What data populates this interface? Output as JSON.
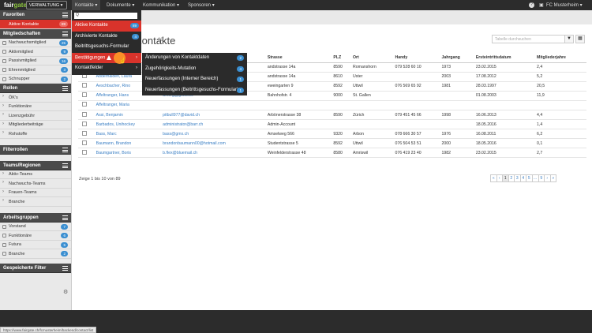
{
  "topbar": {
    "logo_a": "fair",
    "logo_b": "gate",
    "org_switch": "VERWALTUNG",
    "nav": [
      "Kontakte",
      "Dokumente",
      "Kommunikation",
      "Sponsoren"
    ],
    "help": "?",
    "user": "FC Musterheim"
  },
  "sidebar": {
    "favoriten": {
      "title": "Favoriten",
      "items": [
        {
          "label": "Aktive Kontakte",
          "count": "89"
        }
      ]
    },
    "mitgliedschaften": {
      "title": "Mitgliedschaften",
      "items": [
        {
          "label": "Nachwuchsmitglied",
          "count": "25"
        },
        {
          "label": "Aktivmitglied",
          "count": "9"
        },
        {
          "label": "Passivmitglied",
          "count": "16"
        },
        {
          "label": "Ehrenmitglied",
          "count": "3"
        },
        {
          "label": "Schnupper",
          "count": "2"
        }
      ]
    },
    "rollen": {
      "title": "Rollen",
      "items": [
        "ÖK's",
        "Funktionäre",
        "Lizenzgebühr",
        "Mitgliederbeiträge",
        "Rohstoffe"
      ]
    },
    "filterrollen": {
      "title": "Filterrollen"
    },
    "teams": {
      "title": "Teams/Regionen",
      "items": [
        "Aktiv-Teams",
        "Nachwuchs-Teams",
        "Frauen-Teams",
        "Branche"
      ]
    },
    "arbeitsgruppen": {
      "title": "Arbeitsgruppen",
      "items": [
        {
          "label": "Vorstand",
          "count": "7"
        },
        {
          "label": "Funktionäre",
          "count": "6"
        },
        {
          "label": "Futura",
          "count": "5"
        },
        {
          "label": "Branche",
          "count": "2"
        }
      ]
    },
    "gespeichert": {
      "title": "Gespeicherte Filter"
    }
  },
  "page": {
    "title": "Kontakte",
    "count": "89",
    "filter_placeholder": "Tabelle durchsuchen"
  },
  "kontakte_menu": {
    "search": "Q",
    "items": [
      {
        "label": "Aktive Kontakte",
        "count": "89"
      },
      {
        "label": "Archivierte Kontakte",
        "count": "4"
      },
      {
        "label": "Beitrittsgesuchs-Formular",
        "count": ""
      },
      {
        "label": "Bestätigungen",
        "count": ""
      },
      {
        "label": "Kontaktfelder",
        "count": ""
      }
    ]
  },
  "bestaetigungen_menu": {
    "items": [
      {
        "label": "Änderungen von Kontaktdaten",
        "count": "2"
      },
      {
        "label": "Zugehörigkeits-Mutation",
        "count": "4"
      },
      {
        "label": "Neuerfassungen (Interner Bereich)",
        "count": "1"
      },
      {
        "label": "Neuerfassungen (Beitrittsgesuchs-Formular)",
        "count": "1"
      }
    ]
  },
  "table": {
    "headers": [
      "",
      "Name",
      "E-Mail",
      "Strasse",
      "PLZ",
      "Ort",
      "Handy",
      "Jahrgang",
      "Ersteintrittsdatum",
      "Mitgliederjahre"
    ],
    "rows": [
      [
        "",
        "",
        "",
        "andstrasse 14a",
        "8590",
        "Romanshorn",
        "079 528 60 10",
        "1973",
        "23.02.2015",
        "2,4"
      ],
      [
        "",
        "Abderhalden, Laura",
        "",
        "andstrasse 14a",
        "8610",
        "Uster",
        "",
        "2003",
        "17.08.2012",
        "5,2"
      ],
      [
        "",
        "Aeschbacher, Rino",
        "",
        "eweingarten 9",
        "8592",
        "Uttwil",
        "076 569 65 92",
        "1981",
        "28.03.1997",
        "20,5"
      ],
      [
        "",
        "Affeltranger, Hans",
        "d.herg@gmx.net",
        "Bahnhofstr. 4",
        "9000",
        "St. Gallen",
        "",
        "",
        "01.08.2003",
        "11,9"
      ],
      [
        "",
        "Affeltranger, Maria",
        "",
        "",
        "",
        "",
        "",
        "",
        "",
        ""
      ],
      [
        "",
        "Assi, Benjamin",
        "pitbull977@david.ch",
        "Arbönerstrasse 38",
        "8590",
        "Zürich",
        "079 451 45 66",
        "1998",
        "16.06.2013",
        "4,4"
      ],
      [
        "",
        "Barbados, Unihockey",
        "administrator@barr.ch",
        "Admin-Account",
        "",
        "",
        "",
        "",
        "18.05.2016",
        "1,4"
      ],
      [
        "",
        "Bass, Marc",
        "bass@gmx.ch",
        "Amselweg 566",
        "9320",
        "Arbon",
        "078 666 30 57",
        "1976",
        "16.08.2011",
        "6,2"
      ],
      [
        "",
        "Baumann, Brandon",
        "brandonbaumann00@hotmail.com",
        "Studentstrasse 5",
        "8592",
        "Uttwil",
        "076 504 53 51",
        "2000",
        "18.05.2016",
        "0,1"
      ],
      [
        "",
        "Baumgartner, Boris",
        "b.flex@bluemail.ch",
        "Weinfelderstrasse 48",
        "8580",
        "Amriswil",
        "076 419 23 40",
        "1982",
        "23.02.2015",
        "2,7"
      ]
    ]
  },
  "pager": {
    "info": "Zeige 1 bis 10 von 89",
    "pages": [
      "«",
      "‹",
      "1",
      "2",
      "3",
      "4",
      "5",
      "…",
      "9",
      "›",
      "»"
    ],
    "current": "1"
  },
  "statusbar": "https://www.fairgate.ch/fcmusterheim/backend/contact/list",
  "colors": {
    "accent": "#d9332b",
    "badge": "#3b8fd1",
    "dark": "#2c2c2c"
  }
}
